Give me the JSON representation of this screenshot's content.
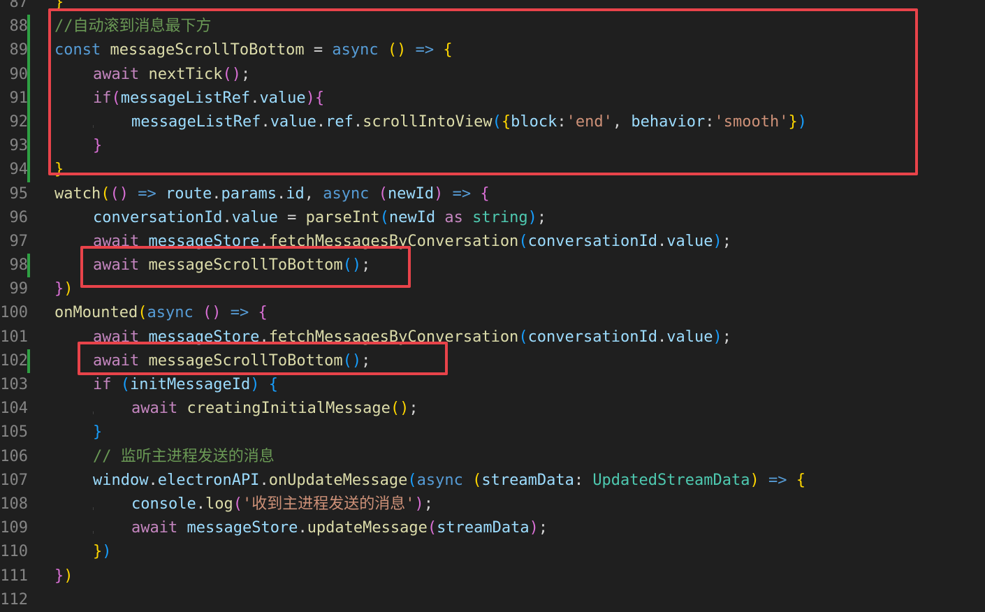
{
  "colors": {
    "background": "#1f1f1f",
    "line_number": "#858585",
    "change_marker": "#2ea043",
    "highlight_box": "#e8434a"
  },
  "lines": [
    {
      "n": "87",
      "indent": 0,
      "changed": false,
      "tokens": [
        {
          "t": "}",
          "c": "p1"
        }
      ]
    },
    {
      "n": "88",
      "indent": 0,
      "changed": true,
      "tokens": [
        {
          "t": "//自动滚到消息最下方",
          "c": "cmt"
        }
      ]
    },
    {
      "n": "89",
      "indent": 0,
      "changed": true,
      "tokens": [
        {
          "t": "const",
          "c": "kw"
        },
        {
          "t": " ",
          "c": "pl"
        },
        {
          "t": "messageScrollToBottom",
          "c": "fn"
        },
        {
          "t": " = ",
          "c": "pl"
        },
        {
          "t": "async",
          "c": "kw"
        },
        {
          "t": " ",
          "c": "pl"
        },
        {
          "t": "()",
          "c": "p1"
        },
        {
          "t": " ",
          "c": "pl"
        },
        {
          "t": "=>",
          "c": "kw"
        },
        {
          "t": " ",
          "c": "pl"
        },
        {
          "t": "{",
          "c": "p1"
        }
      ]
    },
    {
      "n": "90",
      "indent": 1,
      "changed": true,
      "tokens": [
        {
          "t": "await",
          "c": "ctrl"
        },
        {
          "t": " ",
          "c": "pl"
        },
        {
          "t": "nextTick",
          "c": "fn"
        },
        {
          "t": "()",
          "c": "p2"
        },
        {
          "t": ";",
          "c": "pl"
        }
      ]
    },
    {
      "n": "91",
      "indent": 1,
      "changed": true,
      "tokens": [
        {
          "t": "if",
          "c": "ctrl"
        },
        {
          "t": "(",
          "c": "p2"
        },
        {
          "t": "messageListRef",
          "c": "var"
        },
        {
          "t": ".",
          "c": "pl"
        },
        {
          "t": "value",
          "c": "var"
        },
        {
          "t": ")",
          "c": "p2"
        },
        {
          "t": "{",
          "c": "p2"
        }
      ]
    },
    {
      "n": "92",
      "indent": 2,
      "changed": true,
      "tokens": [
        {
          "t": "messageListRef",
          "c": "var"
        },
        {
          "t": ".",
          "c": "pl"
        },
        {
          "t": "value",
          "c": "var"
        },
        {
          "t": ".",
          "c": "pl"
        },
        {
          "t": "ref",
          "c": "var"
        },
        {
          "t": ".",
          "c": "pl"
        },
        {
          "t": "scrollIntoView",
          "c": "fn"
        },
        {
          "t": "(",
          "c": "p3"
        },
        {
          "t": "{",
          "c": "p1"
        },
        {
          "t": "block",
          "c": "var"
        },
        {
          "t": ":",
          "c": "pl"
        },
        {
          "t": "'end'",
          "c": "str"
        },
        {
          "t": ", ",
          "c": "pl"
        },
        {
          "t": "behavior",
          "c": "var"
        },
        {
          "t": ":",
          "c": "pl"
        },
        {
          "t": "'smooth'",
          "c": "str"
        },
        {
          "t": "}",
          "c": "p1"
        },
        {
          "t": ")",
          "c": "p3"
        }
      ]
    },
    {
      "n": "93",
      "indent": 1,
      "changed": true,
      "tokens": [
        {
          "t": "}",
          "c": "p2"
        }
      ]
    },
    {
      "n": "94",
      "indent": 0,
      "changed": true,
      "tokens": [
        {
          "t": "}",
          "c": "p1"
        }
      ]
    },
    {
      "n": "95",
      "indent": 0,
      "changed": false,
      "tokens": [
        {
          "t": "watch",
          "c": "fn"
        },
        {
          "t": "(",
          "c": "p1"
        },
        {
          "t": "()",
          "c": "p2"
        },
        {
          "t": " ",
          "c": "pl"
        },
        {
          "t": "=>",
          "c": "kw"
        },
        {
          "t": " ",
          "c": "pl"
        },
        {
          "t": "route",
          "c": "var"
        },
        {
          "t": ".",
          "c": "pl"
        },
        {
          "t": "params",
          "c": "var"
        },
        {
          "t": ".",
          "c": "pl"
        },
        {
          "t": "id",
          "c": "var"
        },
        {
          "t": ", ",
          "c": "pl"
        },
        {
          "t": "async",
          "c": "kw"
        },
        {
          "t": " ",
          "c": "pl"
        },
        {
          "t": "(",
          "c": "p2"
        },
        {
          "t": "newId",
          "c": "var"
        },
        {
          "t": ")",
          "c": "p2"
        },
        {
          "t": " ",
          "c": "pl"
        },
        {
          "t": "=>",
          "c": "kw"
        },
        {
          "t": " ",
          "c": "pl"
        },
        {
          "t": "{",
          "c": "p2"
        }
      ]
    },
    {
      "n": "96",
      "indent": 1,
      "changed": false,
      "tokens": [
        {
          "t": "conversationId",
          "c": "var"
        },
        {
          "t": ".",
          "c": "pl"
        },
        {
          "t": "value",
          "c": "var"
        },
        {
          "t": " = ",
          "c": "pl"
        },
        {
          "t": "parseInt",
          "c": "fn"
        },
        {
          "t": "(",
          "c": "p3"
        },
        {
          "t": "newId",
          "c": "var"
        },
        {
          "t": " ",
          "c": "pl"
        },
        {
          "t": "as",
          "c": "ctrl"
        },
        {
          "t": " ",
          "c": "pl"
        },
        {
          "t": "string",
          "c": "typ"
        },
        {
          "t": ")",
          "c": "p3"
        },
        {
          "t": ";",
          "c": "pl"
        }
      ]
    },
    {
      "n": "97",
      "indent": 1,
      "changed": false,
      "tokens": [
        {
          "t": "await",
          "c": "ctrl"
        },
        {
          "t": " ",
          "c": "pl"
        },
        {
          "t": "messageStore",
          "c": "var"
        },
        {
          "t": ".",
          "c": "pl"
        },
        {
          "t": "fetchMessagesByConversation",
          "c": "fn"
        },
        {
          "t": "(",
          "c": "p3"
        },
        {
          "t": "conversationId",
          "c": "var"
        },
        {
          "t": ".",
          "c": "pl"
        },
        {
          "t": "value",
          "c": "var"
        },
        {
          "t": ")",
          "c": "p3"
        },
        {
          "t": ";",
          "c": "pl"
        }
      ]
    },
    {
      "n": "98",
      "indent": 1,
      "changed": true,
      "tokens": [
        {
          "t": "await",
          "c": "ctrl"
        },
        {
          "t": " ",
          "c": "pl"
        },
        {
          "t": "messageScrollToBottom",
          "c": "fn"
        },
        {
          "t": "()",
          "c": "p3"
        },
        {
          "t": ";",
          "c": "pl"
        }
      ]
    },
    {
      "n": "99",
      "indent": 0,
      "changed": false,
      "tokens": [
        {
          "t": "}",
          "c": "p2"
        },
        {
          "t": ")",
          "c": "p1"
        }
      ]
    },
    {
      "n": "100",
      "indent": 0,
      "changed": false,
      "tokens": [
        {
          "t": "onMounted",
          "c": "fn"
        },
        {
          "t": "(",
          "c": "p1"
        },
        {
          "t": "async",
          "c": "kw"
        },
        {
          "t": " ",
          "c": "pl"
        },
        {
          "t": "()",
          "c": "p2"
        },
        {
          "t": " ",
          "c": "pl"
        },
        {
          "t": "=>",
          "c": "kw"
        },
        {
          "t": " ",
          "c": "pl"
        },
        {
          "t": "{",
          "c": "p2"
        }
      ]
    },
    {
      "n": "101",
      "indent": 1,
      "changed": false,
      "tokens": [
        {
          "t": "await",
          "c": "ctrl"
        },
        {
          "t": " ",
          "c": "pl"
        },
        {
          "t": "messageStore",
          "c": "var"
        },
        {
          "t": ".",
          "c": "pl"
        },
        {
          "t": "fetchMessagesByConversation",
          "c": "fn"
        },
        {
          "t": "(",
          "c": "p3"
        },
        {
          "t": "conversationId",
          "c": "var"
        },
        {
          "t": ".",
          "c": "pl"
        },
        {
          "t": "value",
          "c": "var"
        },
        {
          "t": ")",
          "c": "p3"
        },
        {
          "t": ";",
          "c": "pl"
        }
      ]
    },
    {
      "n": "102",
      "indent": 1,
      "changed": true,
      "tokens": [
        {
          "t": "await",
          "c": "ctrl"
        },
        {
          "t": " ",
          "c": "pl"
        },
        {
          "t": "messageScrollToBottom",
          "c": "fn"
        },
        {
          "t": "()",
          "c": "p3"
        },
        {
          "t": ";",
          "c": "pl"
        }
      ]
    },
    {
      "n": "103",
      "indent": 1,
      "changed": false,
      "tokens": [
        {
          "t": "if",
          "c": "ctrl"
        },
        {
          "t": " ",
          "c": "pl"
        },
        {
          "t": "(",
          "c": "p3"
        },
        {
          "t": "initMessageId",
          "c": "var"
        },
        {
          "t": ")",
          "c": "p3"
        },
        {
          "t": " ",
          "c": "pl"
        },
        {
          "t": "{",
          "c": "p3"
        }
      ]
    },
    {
      "n": "104",
      "indent": 2,
      "changed": false,
      "tokens": [
        {
          "t": "await",
          "c": "ctrl"
        },
        {
          "t": " ",
          "c": "pl"
        },
        {
          "t": "creatingInitialMessage",
          "c": "fn"
        },
        {
          "t": "()",
          "c": "p1"
        },
        {
          "t": ";",
          "c": "pl"
        }
      ]
    },
    {
      "n": "105",
      "indent": 1,
      "changed": false,
      "tokens": [
        {
          "t": "}",
          "c": "p3"
        }
      ]
    },
    {
      "n": "106",
      "indent": 1,
      "changed": false,
      "tokens": [
        {
          "t": "// 监听主进程发送的消息",
          "c": "cmt"
        }
      ]
    },
    {
      "n": "107",
      "indent": 1,
      "changed": false,
      "tokens": [
        {
          "t": "window",
          "c": "var"
        },
        {
          "t": ".",
          "c": "pl"
        },
        {
          "t": "electronAPI",
          "c": "var"
        },
        {
          "t": ".",
          "c": "pl"
        },
        {
          "t": "onUpdateMessage",
          "c": "fn"
        },
        {
          "t": "(",
          "c": "p3"
        },
        {
          "t": "async",
          "c": "kw"
        },
        {
          "t": " ",
          "c": "pl"
        },
        {
          "t": "(",
          "c": "p1"
        },
        {
          "t": "streamData",
          "c": "var"
        },
        {
          "t": ": ",
          "c": "pl"
        },
        {
          "t": "UpdatedStreamData",
          "c": "typ"
        },
        {
          "t": ")",
          "c": "p1"
        },
        {
          "t": " ",
          "c": "pl"
        },
        {
          "t": "=>",
          "c": "kw"
        },
        {
          "t": " ",
          "c": "pl"
        },
        {
          "t": "{",
          "c": "p1"
        }
      ]
    },
    {
      "n": "108",
      "indent": 2,
      "changed": false,
      "tokens": [
        {
          "t": "console",
          "c": "var"
        },
        {
          "t": ".",
          "c": "pl"
        },
        {
          "t": "log",
          "c": "fn"
        },
        {
          "t": "(",
          "c": "p2"
        },
        {
          "t": "'收到主进程发送的消息'",
          "c": "str"
        },
        {
          "t": ")",
          "c": "p2"
        },
        {
          "t": ";",
          "c": "pl"
        }
      ]
    },
    {
      "n": "109",
      "indent": 2,
      "changed": false,
      "tokens": [
        {
          "t": "await",
          "c": "ctrl"
        },
        {
          "t": " ",
          "c": "pl"
        },
        {
          "t": "messageStore",
          "c": "var"
        },
        {
          "t": ".",
          "c": "pl"
        },
        {
          "t": "updateMessage",
          "c": "fn"
        },
        {
          "t": "(",
          "c": "p2"
        },
        {
          "t": "streamData",
          "c": "var"
        },
        {
          "t": ")",
          "c": "p2"
        },
        {
          "t": ";",
          "c": "pl"
        }
      ]
    },
    {
      "n": "110",
      "indent": 1,
      "changed": false,
      "tokens": [
        {
          "t": "}",
          "c": "p1"
        },
        {
          "t": ")",
          "c": "p3"
        }
      ]
    },
    {
      "n": "111",
      "indent": 0,
      "changed": false,
      "tokens": [
        {
          "t": "}",
          "c": "p2"
        },
        {
          "t": ")",
          "c": "p1"
        }
      ]
    },
    {
      "n": "112",
      "indent": 0,
      "changed": false,
      "tokens": []
    }
  ]
}
